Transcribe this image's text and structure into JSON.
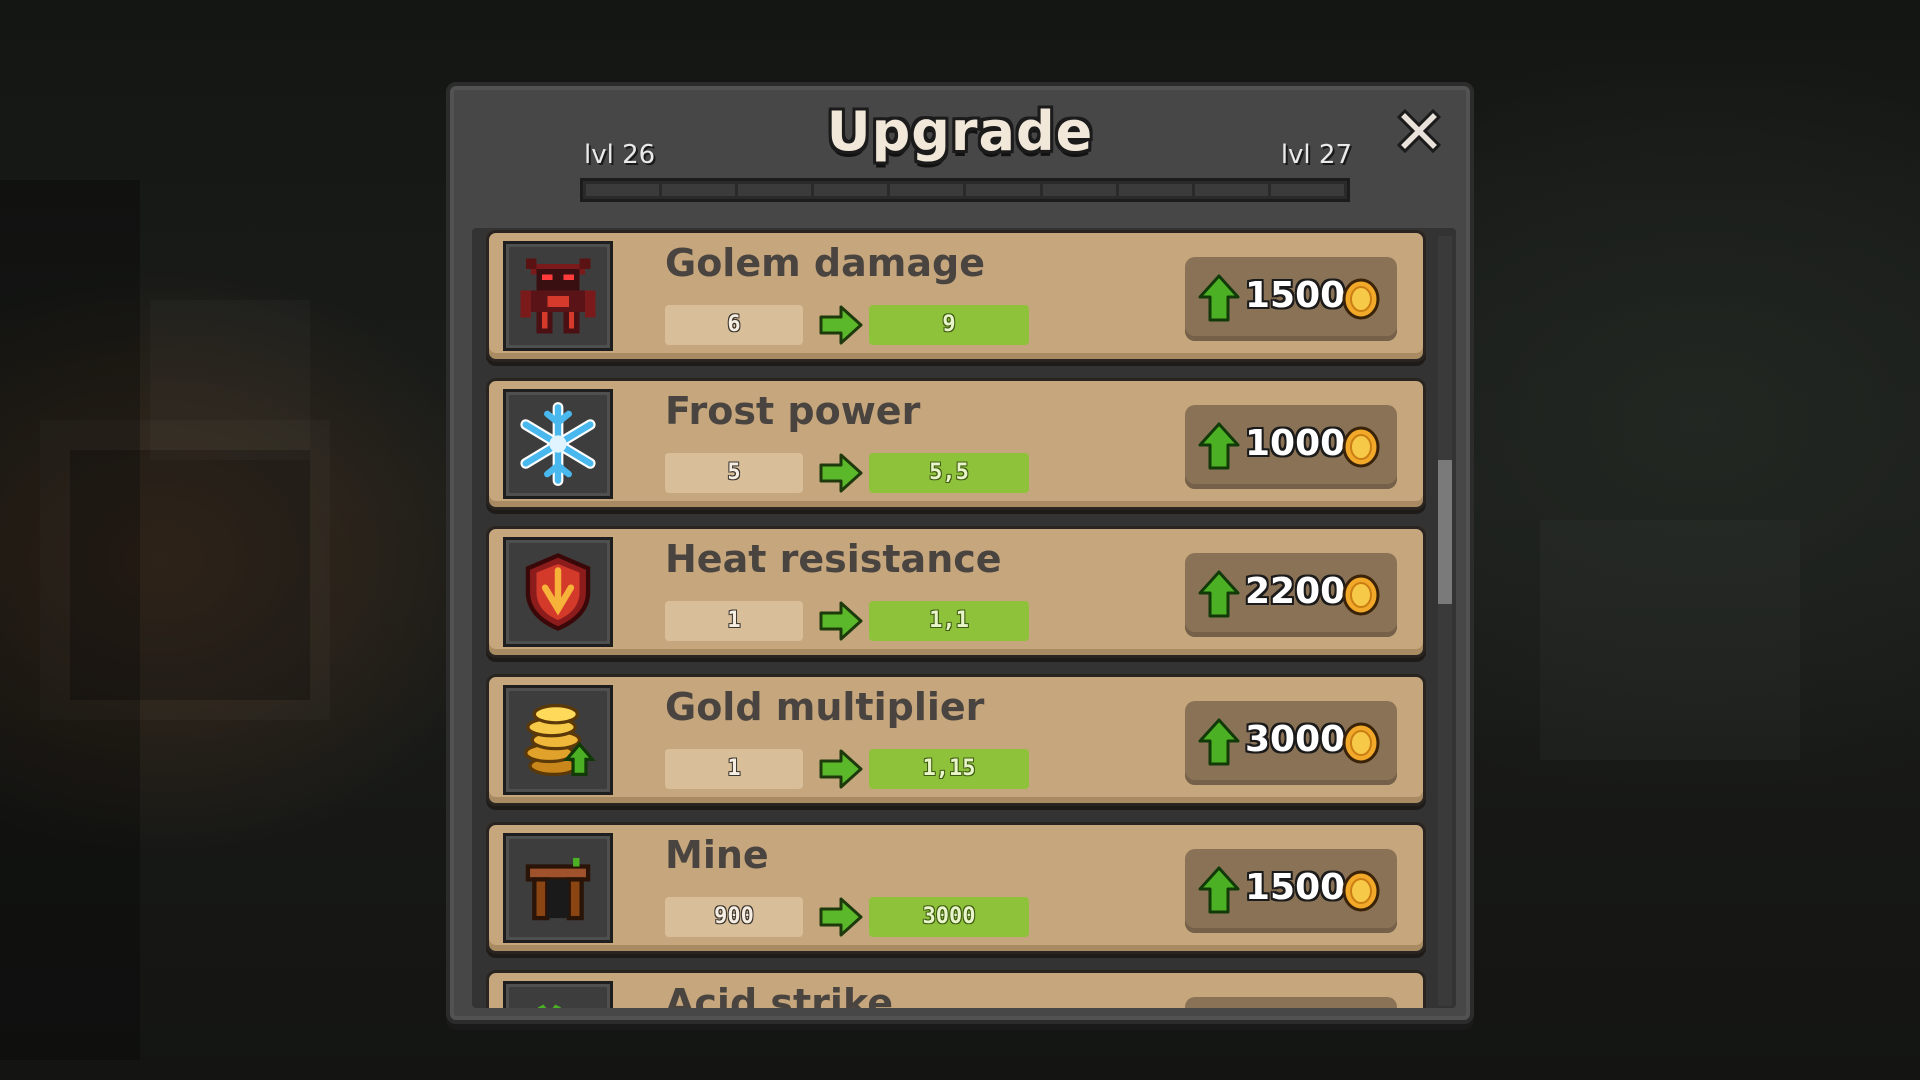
{
  "dialog": {
    "title": "Upgrade",
    "level_from": "lvl 26",
    "level_to": "lvl 27",
    "close_icon": "close-icon",
    "xp_segments": 10,
    "xp_filled": 0
  },
  "upgrades": [
    {
      "name": "Golem damage",
      "icon": "golem-icon",
      "current": "6",
      "next": "9",
      "cost": "1500"
    },
    {
      "name": "Frost power",
      "icon": "snowflake-icon",
      "current": "5",
      "next": "5,5",
      "cost": "1000"
    },
    {
      "name": "Heat resistance",
      "icon": "fire-shield-icon",
      "current": "1",
      "next": "1,1",
      "cost": "2200"
    },
    {
      "name": "Gold multiplier",
      "icon": "gold-coins-icon",
      "current": "1",
      "next": "1,15",
      "cost": "3000"
    },
    {
      "name": "Mine",
      "icon": "mine-icon",
      "current": "900",
      "next": "3000",
      "cost": "1500"
    },
    {
      "name": "Acid strike",
      "icon": "acid-icon"
    }
  ],
  "colors": {
    "card": "#c6a67c",
    "next_value": "#8fc23b",
    "buy_button": "#8a7256",
    "coin": "#f2a92a"
  }
}
